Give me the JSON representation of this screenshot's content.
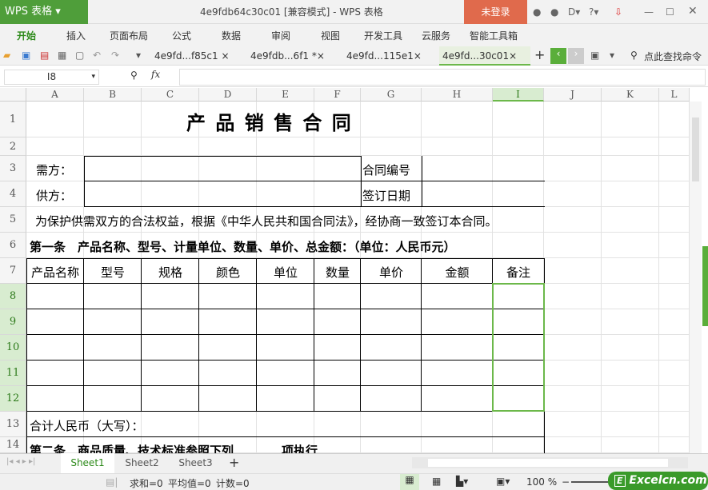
{
  "app": {
    "logo": "WPS 表格",
    "title": "4e9fdb64c30c01 [兼容模式] - WPS 表格",
    "login": "未登录"
  },
  "menu": [
    "开始",
    "插入",
    "页面布局",
    "公式",
    "数据",
    "审阅",
    "视图",
    "开发工具",
    "云服务",
    "智能工具箱"
  ],
  "doc_tabs": [
    "4e9fd...f85c1",
    "4e9fdb...6f1 *",
    "4e9fd...115e1",
    "4e9fd...30c01"
  ],
  "search_command": "点此查找命令",
  "formula": {
    "name_box": "I8",
    "fx": "fx",
    "value": ""
  },
  "columns": [
    "A",
    "B",
    "C",
    "D",
    "E",
    "F",
    "G",
    "H",
    "I",
    "J",
    "K",
    "L"
  ],
  "rows": [
    "1",
    "2",
    "3",
    "4",
    "5",
    "6",
    "7",
    "8",
    "9",
    "10",
    "11",
    "12",
    "13",
    "14"
  ],
  "cells": {
    "title": "产 品 销 售 合 同",
    "buyer": "需方：",
    "supplier": "供方：",
    "contract_no": "合同编号",
    "sign_date": "签订日期",
    "r5": "为保护供需双方的合法权益，根据《中华人民共和国合同法》，经协商一致签订本合同。",
    "r6": "第一条　产品名称、型号、计量单位、数量、单价、总金额：（单位：人民币元）",
    "headers": [
      "产品名称",
      "型号",
      "规格",
      "颜色",
      "单位",
      "数量",
      "单价",
      "金额",
      "备注"
    ],
    "r13": "合计人民币（大写）：",
    "r14": "第二条　商品质量、技术标准参照下列　　　　项执行"
  },
  "sheets": [
    "Sheet1",
    "Sheet2",
    "Sheet3"
  ],
  "status": {
    "sum": "求和=0",
    "avg": "平均值=0",
    "count": "计数=0",
    "zoom": "100 %",
    "watermark": "Excelcn.com"
  }
}
